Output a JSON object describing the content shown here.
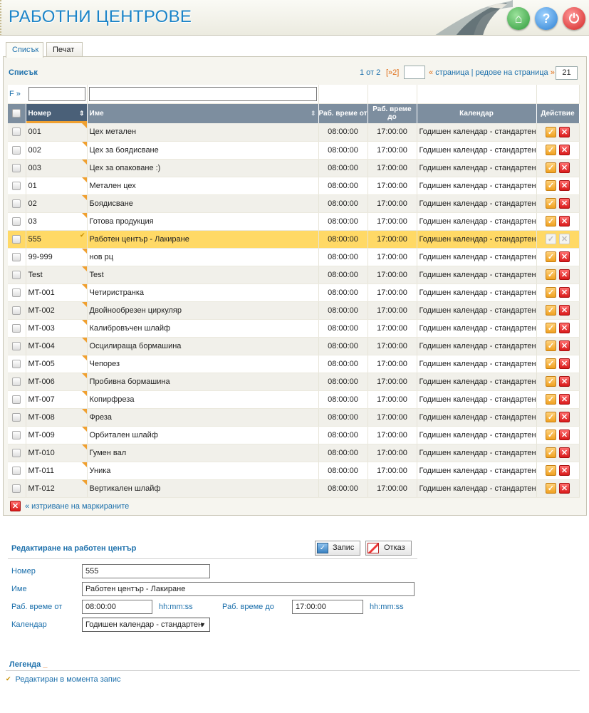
{
  "header": {
    "title": "РАБОТНИ ЦЕНТРОВЕ"
  },
  "tabs": [
    {
      "label": "Списък"
    },
    {
      "label": "Печат"
    }
  ],
  "list": {
    "title": "Списък",
    "pager": {
      "page_info": "1 от 2",
      "next": "[»2]",
      "page_label": "страница | редове на страница",
      "rows_per_page": "21",
      "prefix_arrow": "«",
      "suffix_arrow": "»"
    },
    "filter_label": "F »",
    "columns": {
      "number": "Номер",
      "name": "Име",
      "time_from": "Раб. време от",
      "time_to": "Раб. време до",
      "calendar": "Календар",
      "action": "Действие"
    },
    "rows": [
      {
        "number": "001",
        "name": "Цех метален",
        "from": "08:00:00",
        "to": "17:00:00",
        "calendar": "Годишен календар - стандартен"
      },
      {
        "number": "002",
        "name": "Цех за боядисване",
        "from": "08:00:00",
        "to": "17:00:00",
        "calendar": "Годишен календар - стандартен"
      },
      {
        "number": "003",
        "name": "Цех за опаковане :)",
        "from": "08:00:00",
        "to": "17:00:00",
        "calendar": "Годишен календар - стандартен"
      },
      {
        "number": "01",
        "name": "Метален цех",
        "from": "08:00:00",
        "to": "17:00:00",
        "calendar": "Годишен календар - стандартен"
      },
      {
        "number": "02",
        "name": "Боядисване",
        "from": "08:00:00",
        "to": "17:00:00",
        "calendar": "Годишен календар - стандартен"
      },
      {
        "number": "03",
        "name": "Готова продукция",
        "from": "08:00:00",
        "to": "17:00:00",
        "calendar": "Годишен календар - стандартен"
      },
      {
        "number": "555",
        "name": "Работен център - Лакиране",
        "from": "08:00:00",
        "to": "17:00:00",
        "calendar": "Годишен календар - стандартен",
        "selected": true
      },
      {
        "number": "99-999",
        "name": "нов рц",
        "from": "08:00:00",
        "to": "17:00:00",
        "calendar": "Годишен календар - стандартен"
      },
      {
        "number": "Test",
        "name": "Test",
        "from": "08:00:00",
        "to": "17:00:00",
        "calendar": "Годишен календар - стандартен"
      },
      {
        "number": "MT-001",
        "name": "Четиристранка",
        "from": "08:00:00",
        "to": "17:00:00",
        "calendar": "Годишен календар - стандартен"
      },
      {
        "number": "MT-002",
        "name": "Двойнообрезен циркуляр",
        "from": "08:00:00",
        "to": "17:00:00",
        "calendar": "Годишен календар - стандартен"
      },
      {
        "number": "MT-003",
        "name": "Калибровъчен шлайф",
        "from": "08:00:00",
        "to": "17:00:00",
        "calendar": "Годишен календар - стандартен"
      },
      {
        "number": "MT-004",
        "name": "Осцилираща бормашина",
        "from": "08:00:00",
        "to": "17:00:00",
        "calendar": "Годишен календар - стандартен"
      },
      {
        "number": "MT-005",
        "name": "Чепорез",
        "from": "08:00:00",
        "to": "17:00:00",
        "calendar": "Годишен календар - стандартен"
      },
      {
        "number": "MT-006",
        "name": "Пробивна бормашина",
        "from": "08:00:00",
        "to": "17:00:00",
        "calendar": "Годишен календар - стандартен"
      },
      {
        "number": "MT-007",
        "name": "Копирфреза",
        "from": "08:00:00",
        "to": "17:00:00",
        "calendar": "Годишен календар - стандартен"
      },
      {
        "number": "MT-008",
        "name": "Фреза",
        "from": "08:00:00",
        "to": "17:00:00",
        "calendar": "Годишен календар - стандартен"
      },
      {
        "number": "MT-009",
        "name": "Орбитален шлайф",
        "from": "08:00:00",
        "to": "17:00:00",
        "calendar": "Годишен календар - стандартен"
      },
      {
        "number": "MT-010",
        "name": "Гумен вал",
        "from": "08:00:00",
        "to": "17:00:00",
        "calendar": "Годишен календар - стандартен"
      },
      {
        "number": "MT-011",
        "name": "Уника",
        "from": "08:00:00",
        "to": "17:00:00",
        "calendar": "Годишен календар - стандартен"
      },
      {
        "number": "MT-012",
        "name": "Вертикален шлайф",
        "from": "08:00:00",
        "to": "17:00:00",
        "calendar": "Годишен календар - стандартен"
      }
    ],
    "delete_marked": "« изтриване на маркираните"
  },
  "edit": {
    "title": "Редактиране на работен център",
    "save_label": "Запис",
    "cancel_label": "Отказ",
    "number_label": "Номер",
    "number_value": "555",
    "name_label": "Име",
    "name_value": "Работен център - Лакиране",
    "from_label": "Раб. време от",
    "from_value": "08:00:00",
    "to_label": "Раб. време до",
    "to_value": "17:00:00",
    "time_hint": "hh:mm:ss",
    "calendar_label": "Календар",
    "calendar_value": "Годишен календар - стандартен"
  },
  "legend": {
    "title": "Легенда",
    "item": "Редактиран в момента запис"
  },
  "colors": {
    "accent": "#1b6fab",
    "header_bg": "#7d8e9f",
    "selected_row": "#ffd966",
    "link_orange": "#e0701a"
  }
}
